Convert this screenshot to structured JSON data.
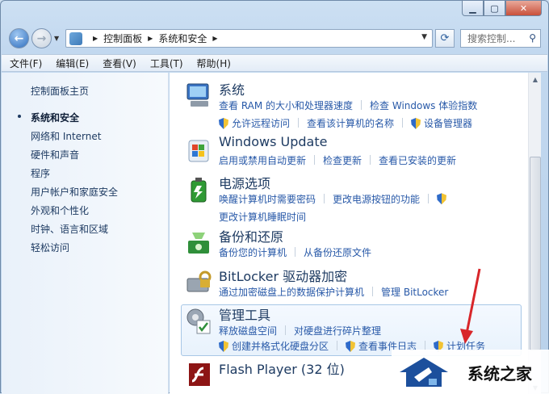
{
  "window": {
    "minimize_glyph": "▁",
    "maximize_glyph": "▢",
    "close_glyph": "✕"
  },
  "nav": {
    "back_glyph": "←",
    "forward_glyph": "→"
  },
  "address": {
    "crumbs": [
      "控制面板",
      "系统和安全"
    ]
  },
  "search": {
    "placeholder": "搜索控制..."
  },
  "menu": [
    "文件(F)",
    "编辑(E)",
    "查看(V)",
    "工具(T)",
    "帮助(H)"
  ],
  "sidebar": {
    "items": [
      "控制面板主页",
      "系统和安全",
      "网络和 Internet",
      "硬件和声音",
      "程序",
      "用户帐户和家庭安全",
      "外观和个性化",
      "时钟、语言和区域",
      "轻松访问"
    ],
    "current": "系统和安全"
  },
  "sections": [
    {
      "title": "系统",
      "icon": "computer-icon",
      "rows": [
        [
          {
            "text": "查看 RAM 的大小和处理器速度"
          },
          {
            "text": "检查 Windows 体验指数"
          }
        ],
        [
          {
            "text": "允许远程访问",
            "shield": true
          },
          {
            "text": "查看该计算机的名称"
          },
          {
            "text": "设备管理器",
            "shield": true
          }
        ]
      ]
    },
    {
      "title": "Windows Update",
      "icon": "windows-update-icon",
      "rows": [
        [
          {
            "text": "启用或禁用自动更新"
          },
          {
            "text": "检查更新"
          },
          {
            "text": "查看已安装的更新"
          }
        ]
      ]
    },
    {
      "title": "电源选项",
      "icon": "battery-icon",
      "rows": [
        [
          {
            "text": "唤醒计算机时需要密码"
          },
          {
            "text": "更改电源按钮的功能"
          },
          {
            "text": "",
            "shield": true
          }
        ],
        [
          {
            "text": "更改计算机睡眠时间"
          }
        ]
      ]
    },
    {
      "title": "备份和还原",
      "icon": "backup-icon",
      "rows": [
        [
          {
            "text": "备份您的计算机"
          },
          {
            "text": "从备份还原文件"
          }
        ]
      ]
    },
    {
      "title": "BitLocker 驱动器加密",
      "icon": "bitlocker-icon",
      "rows": [
        [
          {
            "text": "通过加密磁盘上的数据保护计算机"
          },
          {
            "text": "管理 BitLocker"
          }
        ]
      ]
    },
    {
      "title": "管理工具",
      "icon": "admin-tools-icon",
      "rows": [
        [
          {
            "text": "释放磁盘空间"
          },
          {
            "text": "对硬盘进行碎片整理"
          }
        ],
        [
          {
            "text": "创建并格式化硬盘分区",
            "shield": true
          },
          {
            "text": "查看事件日志",
            "shield": true
          },
          {
            "text": "计划任务",
            "shield": true
          }
        ]
      ]
    },
    {
      "title": "Flash Player (32 位)",
      "icon": "flash-icon",
      "rows": []
    }
  ],
  "watermark": {
    "text": "系统之家"
  },
  "colors": {
    "link": "#2859a8",
    "title": "#1e3b62",
    "arrow": "#d8262a"
  }
}
